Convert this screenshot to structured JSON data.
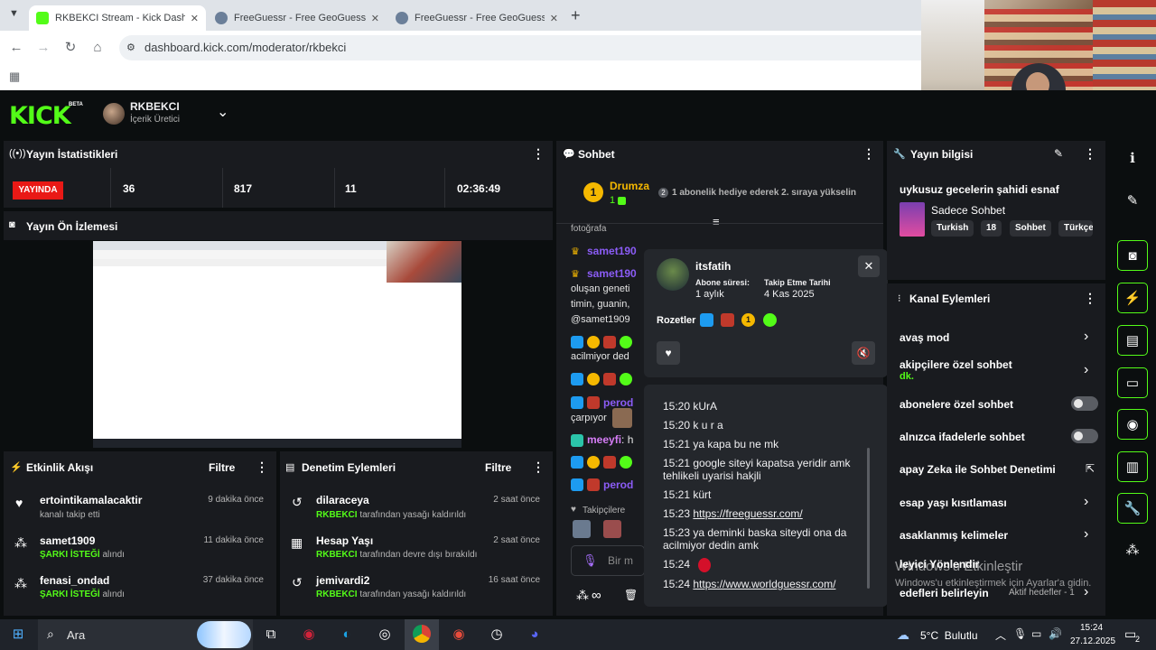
{
  "browser": {
    "tabs": [
      {
        "title": "RKBEKCI Stream - Kick Dashbo",
        "active": true
      },
      {
        "title": "FreeGuessr - Free GeoGuessr A",
        "active": false
      },
      {
        "title": "FreeGuessr - Free GeoGuessr A",
        "active": false
      }
    ],
    "url": "dashboard.kick.com/moderator/rkbekci"
  },
  "header": {
    "logo": "KICK",
    "beta": "BETA",
    "channel_name": "RKBEKCI",
    "channel_role": "İçerik Üretici"
  },
  "stats_panel": {
    "title": "Yayın İstatistikleri",
    "live_label": "YAYINDA",
    "values": [
      "36",
      "817",
      "11",
      "02:36:49"
    ]
  },
  "preview_panel": {
    "title": "Yayın Ön İzlemesi"
  },
  "activity_panel": {
    "title": "Etkinlik Akışı",
    "filter_label": "Filtre",
    "items": [
      {
        "name": "ertointikamalacaktir",
        "sub_highlight": "",
        "sub": "kanalı takip etti",
        "time": "9 dakika önce"
      },
      {
        "name": "samet1909",
        "sub_highlight": "ŞARKI İSTEĞİ",
        "sub": "alındı",
        "time": "11 dakika önce"
      },
      {
        "name": "fenasi_ondad",
        "sub_highlight": "ŞARKI İSTEĞİ",
        "sub": "alındı",
        "time": "37 dakika önce"
      }
    ]
  },
  "moderation_panel": {
    "title": "Denetim Eylemleri",
    "filter_label": "Filtre",
    "items": [
      {
        "name": "dilaraceya",
        "actor": "RKBEKCI",
        "sub": "tarafından yasağı kaldırıldı",
        "time": "2 saat önce"
      },
      {
        "name": "Hesap Yaşı",
        "actor": "RKBEKCI",
        "sub": "tarafından devre dışı bırakıldı",
        "time": "2 saat önce"
      },
      {
        "name": "jemivardi2",
        "actor": "RKBEKCI",
        "sub": "tarafından yasağı kaldırıldı",
        "time": "16 saat önce"
      }
    ]
  },
  "chat_panel": {
    "title": "Sohbet",
    "pinned_user": "Drumza",
    "pinned_count": "1",
    "pinned_badge_num": "2",
    "pinned_text": "1 abonelik hediye ederek 2. sıraya yükselin",
    "partial_top": "fotoğrafa",
    "messages": [
      {
        "name": "samet190",
        "text": ""
      },
      {
        "name": "samet190",
        "text": ""
      },
      {
        "name": "",
        "text": "oluşan geneti"
      },
      {
        "name": "",
        "text": "timin, guanin,"
      },
      {
        "name": "",
        "text": "@samet1909"
      },
      {
        "name": "",
        "text": "acilmiyor ded"
      },
      {
        "name": "perod",
        "text": ""
      },
      {
        "name": "",
        "text": "çarpıyor"
      },
      {
        "name": "meeyfi",
        "text": ": h"
      },
      {
        "name": "perod",
        "text": ""
      }
    ],
    "followers_label": "Takipçilere",
    "input_placeholder": "Bir m"
  },
  "user_card": {
    "username": "itsfatih",
    "sub_label": "Abone süresi:",
    "sub_value": "1 aylık",
    "follow_label": "Takip Etme Tarihi",
    "follow_value": "4 Kas 2025",
    "badges_label": "Rozetler",
    "badge_num": "1"
  },
  "message_history": [
    {
      "time": "15:20",
      "text": "kUrA",
      "link": false
    },
    {
      "time": "15:20",
      "text": "k u r a",
      "link": false
    },
    {
      "time": "15:21",
      "text": "ya kapa bu ne mk",
      "link": false
    },
    {
      "time": "15:21",
      "text": "google siteyi kapatsa yeridir amk tehlikeli uyarisi hakjli",
      "link": false
    },
    {
      "time": "15:21",
      "text": "kürt",
      "link": false
    },
    {
      "time": "15:23",
      "text": "https://freeguessr.com/",
      "link": true
    },
    {
      "time": "15:23",
      "text": "ya deminki baska siteydi ona da acilmiyor dedin amk",
      "link": false
    },
    {
      "time": "15:24",
      "text": "",
      "link": false
    },
    {
      "time": "15:24",
      "text": "https://www.worldguessr.com/",
      "link": true
    }
  ],
  "info_panel": {
    "title": "Yayın bilgisi",
    "stream_title": "uykusuz gecelerin şahidi esnaf",
    "category": "Sadece Sohbet",
    "tags": [
      "Turkish",
      "18",
      "Sohbet",
      "Türkçe"
    ]
  },
  "channel_actions": {
    "title": "Kanal Eylemleri",
    "items": [
      {
        "label": "avaş mod",
        "sub": "",
        "control": "arrow"
      },
      {
        "label": "akipçilere özel sohbet",
        "sub": "dk.",
        "control": "arrow"
      },
      {
        "label": "abonelere özel sohbet",
        "sub": "",
        "control": "toggle"
      },
      {
        "label": "alnızca ifadelerle sohbet",
        "sub": "",
        "control": "toggle"
      },
      {
        "label": "apay Zeka ile Sohbet Denetimi",
        "sub": "",
        "control": "external"
      },
      {
        "label": "esap yaşı kısıtlaması",
        "sub": "",
        "control": "arrow"
      },
      {
        "label": "asaklanmış kelimeler",
        "sub": "",
        "control": "arrow"
      },
      {
        "label": "leyici Yönlendir",
        "sub": "",
        "control": "none"
      },
      {
        "label": "edefleri belirleyin",
        "sub": "Aktif hedefler - 1",
        "control": "arrow"
      }
    ]
  },
  "watermark": {
    "line1": "Windows'u Etkinleştir",
    "line2": "Windows'u etkinleştirmek için Ayarlar'a gidin."
  },
  "taskbar": {
    "search_label": "Ara",
    "weather": "5°C  Bulutlu",
    "time": "15:24",
    "date": "27.12.2025",
    "notif_count": "2"
  }
}
